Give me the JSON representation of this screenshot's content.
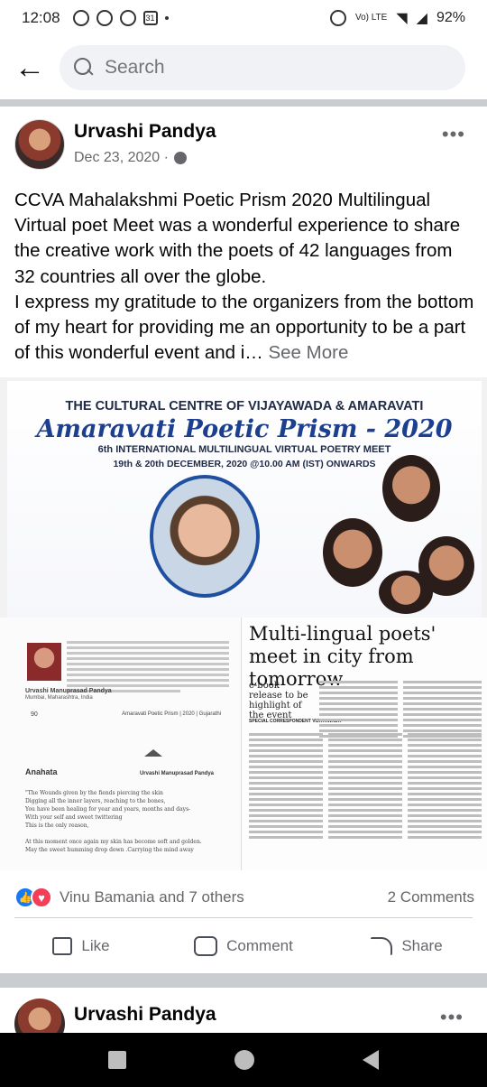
{
  "status_bar": {
    "time": "12:08",
    "battery": "92%",
    "network": "Vo) LTE"
  },
  "search": {
    "placeholder": "Search"
  },
  "post": {
    "author": "Urvashi Pandya",
    "date": "Dec 23, 2020 ·",
    "text": "CCVA Mahalakshmi Poetic Prism 2020 Multilingual Virtual poet Meet was a wonderful experience to share the creative work with the poets of 42 languages from 32 countries all over the globe.\nI express my gratitude to the organizers from the bottom of my heart for providing me an opportunity to be a part of this wonderful event and i…",
    "see_more": "See More",
    "image": {
      "banner_org": "THE CULTURAL CENTRE OF VIJAYAWADA & AMARAVATI",
      "banner_event": "Amaravati Poetic Prism - 2020",
      "banner_sub": "6th INTERNATIONAL MULTILINGUAL VIRTUAL POETRY MEET",
      "banner_dates": "19th & 20th DECEMBER, 2020 @10.00 AM (IST) ONWARDS",
      "clip_author": "Urvashi Manuprasad Pandya",
      "clip_location": "Mumbai, Maharashtra, India",
      "clip_page": "90",
      "clip_footer": "Amaravati Poetic Prism | 2020 | Gujarathi",
      "poem_title": "Anahata",
      "poem_author": "Urvashi Manuprasad Pandya",
      "poem_lines": [
        "\"The Wounds given by the fiends piercing the skin",
        "Digging all the inner layers, reaching to the bones,",
        "You have been healing for year and years, months and days-",
        "With your self and sweet twittering",
        "This is the only reason,",
        "",
        "At this moment once again my skin has become soft and golden.",
        "May the sweet humming drop down .Carrying the mind away"
      ],
      "news_headline": "Multi-lingual poets' meet in city from tomorrow",
      "news_sub": "e-book release to be highlight of the event",
      "news_byline": "SPECIAL CORRESPONDENT VIJAYAWADA"
    },
    "reactions": {
      "names": "Vinu Bamania and 7 others",
      "comments": "2 Comments"
    },
    "actions": {
      "like": "Like",
      "comment": "Comment",
      "share": "Share"
    }
  },
  "next_post": {
    "author": "Urvashi Pandya"
  },
  "colors": {
    "accent": "#1877f2",
    "love": "#f33e58",
    "muted": "#65676b"
  }
}
